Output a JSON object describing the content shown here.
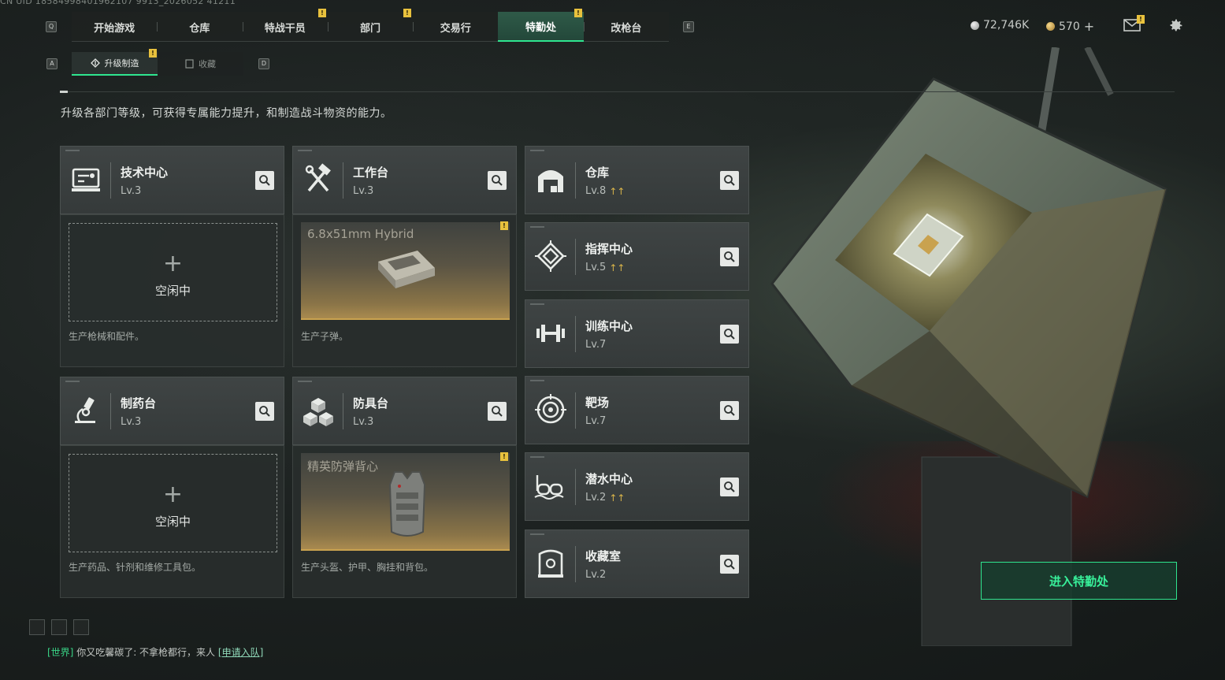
{
  "uid": "CN UID 18584998401962107 9913_2026052 41211",
  "key_hints": {
    "prev_tab": "Q",
    "next_tab": "E",
    "prev_sub": "A",
    "next_sub": "D"
  },
  "tabs": [
    {
      "label": "开始游戏",
      "warn": false
    },
    {
      "label": "仓库",
      "warn": false
    },
    {
      "label": "特战干员",
      "warn": true
    },
    {
      "label": "部门",
      "warn": true
    },
    {
      "label": "交易行",
      "warn": false
    },
    {
      "label": "特勤处",
      "warn": true,
      "active": true
    },
    {
      "label": "改枪台",
      "warn": false
    }
  ],
  "currency": {
    "silver": "72,746K",
    "gold": "570",
    "gold_add": "+"
  },
  "subtabs": [
    {
      "label": "升级制造",
      "active": true,
      "warn": true
    },
    {
      "label": "收藏",
      "active": false
    }
  ],
  "description": "升级各部门等级，可获得专属能力提升，和制造战斗物资的能力。",
  "warn_glyph": "!",
  "production": [
    {
      "name": "技术中心",
      "level": "Lv.3",
      "icon": "monitor-icon",
      "status": "空闲中",
      "caption": "生产枪械和配件。"
    },
    {
      "name": "工作台",
      "level": "Lv.3",
      "icon": "hammer-wrench-icon",
      "item": "6.8x51mm Hybrid",
      "caption": "生产子弹。"
    },
    {
      "name": "制药台",
      "level": "Lv.3",
      "icon": "microscope-icon",
      "status": "空闲中",
      "caption": "生产药品、针剂和维修工具包。"
    },
    {
      "name": "防具台",
      "level": "Lv.3",
      "icon": "cubes-icon",
      "item": "精英防弹背心",
      "caption": "生产头盔、护甲、胸挂和背包。"
    }
  ],
  "departments": [
    {
      "name": "仓库",
      "level": "Lv.8",
      "upgrade": true,
      "icon": "warehouse-icon"
    },
    {
      "name": "指挥中心",
      "level": "Lv.5",
      "upgrade": true,
      "icon": "command-chip-icon"
    },
    {
      "name": "训练中心",
      "level": "Lv.7",
      "upgrade": false,
      "icon": "dumbbell-icon"
    },
    {
      "name": "靶场",
      "level": "Lv.7",
      "upgrade": false,
      "icon": "target-icon"
    },
    {
      "name": "潜水中心",
      "level": "Lv.2",
      "upgrade": true,
      "icon": "diving-mask-icon"
    },
    {
      "name": "收藏室",
      "level": "Lv.2",
      "upgrade": false,
      "icon": "collection-icon"
    }
  ],
  "enter_button": "进入特勤处",
  "chat": {
    "channel": "[世界]",
    "message": "你又吃馨碳了: 不拿枪都行，来人",
    "link": "[申请入队]"
  },
  "colors": {
    "accent": "#2fe58f",
    "warning": "#e8c13d",
    "upgrade": "#d9b44a"
  }
}
